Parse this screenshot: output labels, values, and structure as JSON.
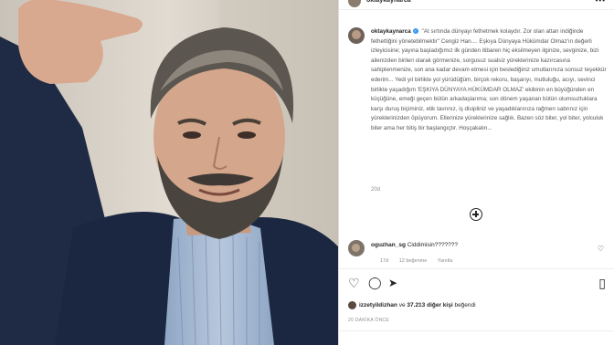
{
  "header": {
    "username": "oktaykaynarca",
    "more_icon": "more-dots-icon"
  },
  "caption": {
    "username": "oktaykaynarca",
    "verified": "✓",
    "text": "\"At sırtında dünyayı fethetmek kolaydır. Zor olan attan indiğinde fethettiğini yönetebilmektir\" Cengiz Han.... Eşkıya Dünyaya Hükümdar Olmaz'ın değerli izleyicisine; yayına başladığımız ilk günden itibaren hiç eksilmeyen ilginize, sevginize, bizi ailenizden birileri olarak görmenize, sorgusuz sualsiz yüreklerinize kazırcasına sahiplenmenize, son ana kadar devam etmesi için beslediğiniz umutlarınıza sonsuz teşekkür ederim... Yedi yıl birlikte yol yürüdüğüm, birçok rekoru, başarıyı, mutluluğu, acıyı, sevinci birlikte yaşadığım 'EŞKIYA DÜNYAYA HÜKÜMDAR OLMAZ' ekibinin en büyüğünden en küçüğüne, emeği geçen bütün arkadaşlarıma; son dönem yaşanan bütün olumsuzluklara karşı duruş biçiminiz, etik tavrınız, iş disipliniz ve yaşadıklarınıza rağmen sabrınız için yüreklerinizden öpüyorum. Ellerinize yüreklerinize sağlık. Bazen söz biter, yol biter, yolculuk biter ama her bitiş bir başlangıçtır. Hoşçakalın...",
    "time": "20d"
  },
  "comment": {
    "username": "oguzhan_sg",
    "text": "Ciddimisin???????",
    "time": "17d",
    "likes": "12 beğenme",
    "reply": "Yanıtla"
  },
  "actions": {
    "like_icon": "♡",
    "comment_icon": "◯",
    "share_icon": "➤",
    "save_icon": "▯"
  },
  "likes": {
    "user": "izzetyildizhan",
    "rest": "ve",
    "count": "37.213 diğer kişi",
    "suffix": "beğendi"
  },
  "date": "20 DAKİKA ÖNCE"
}
